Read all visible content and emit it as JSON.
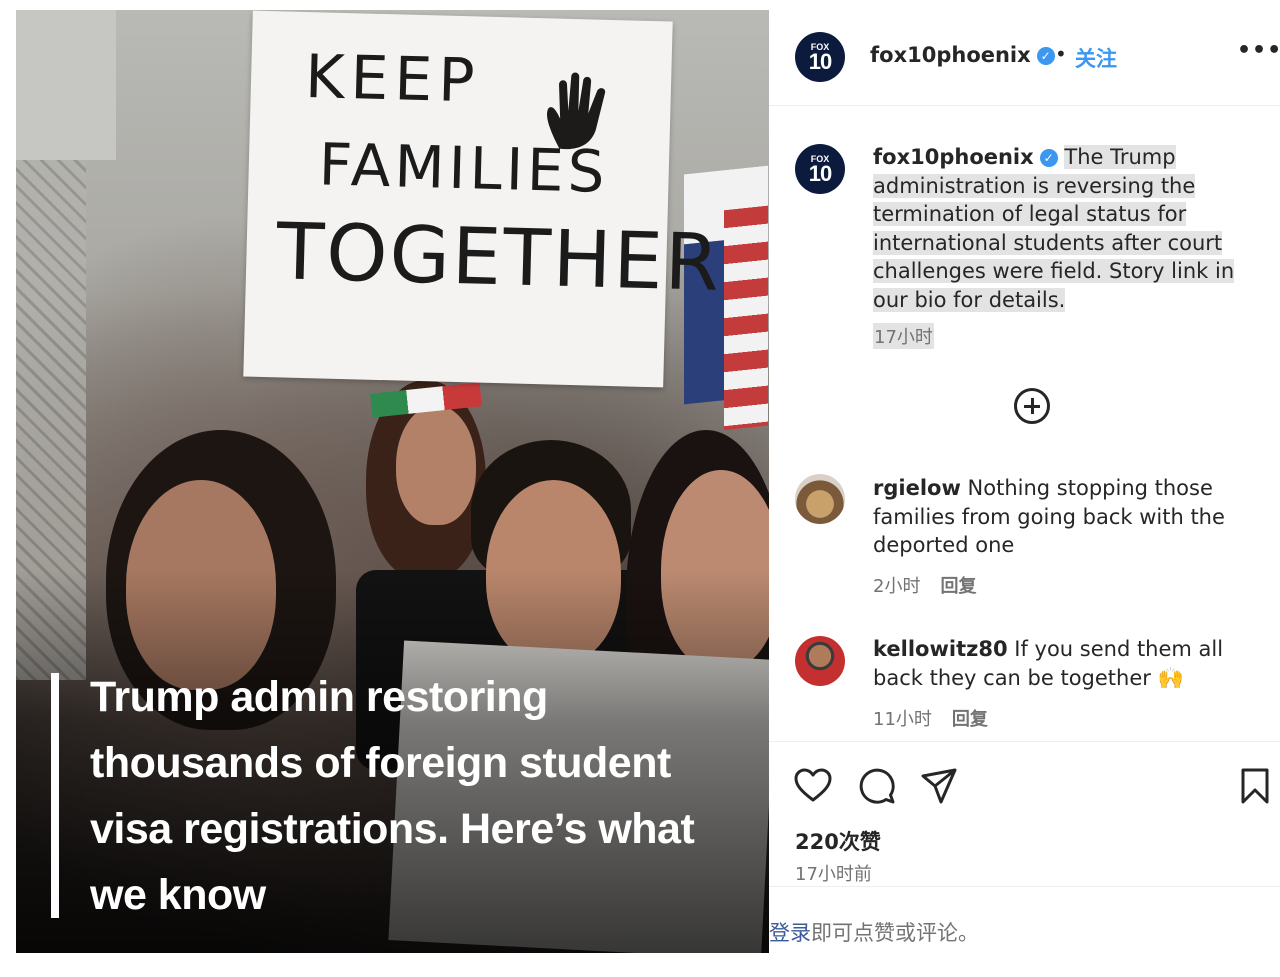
{
  "post": {
    "overlay_title": "Trump admin restoring thousands of foreign student visa registrations. Here’s what we know",
    "sign_line1": "KEEP",
    "sign_line2": "FAMILIES",
    "sign_line3": "TOGETHER"
  },
  "header": {
    "avatar_top": "FOX",
    "avatar_bottom": "10",
    "username": "fox10phoenix",
    "separator": "•",
    "follow_label": "关注",
    "more_label": "•••"
  },
  "caption": {
    "username": "fox10phoenix",
    "text": "The Trump administration is reversing the termination of legal status for international students after court challenges were field. Story link in our bio for details.",
    "time": "17小时"
  },
  "comments": [
    {
      "username": "rgielow",
      "text": "Nothing stopping those families from going back with the deported one",
      "time": "2小时",
      "reply_label": "回复"
    },
    {
      "username": "kellowitz80",
      "text": "If you send them all back they can be together 🙌",
      "time": "11小时",
      "reply_label": "回复"
    }
  ],
  "engagement": {
    "likes": "220次赞",
    "posted_ago": "17小时前"
  },
  "footer": {
    "login_link": "登录",
    "login_rest": "即可点赞或评论。"
  },
  "colors": {
    "accent_blue": "#3b97f0",
    "text": "#262626",
    "muted": "#737373",
    "fox_navy": "#0c1b3d"
  },
  "icons": [
    "verified-icon",
    "more-icon",
    "load-more-icon",
    "heart-icon",
    "comment-icon",
    "share-icon",
    "bookmark-icon"
  ]
}
